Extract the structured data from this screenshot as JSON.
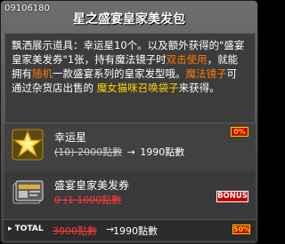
{
  "item_id": "09106180",
  "title": "星之盛宴皇家美发包",
  "description": {
    "line1": "飘洒展示道具：幸运星10个。以及额外获得的\"盛宴",
    "line2_a": "皇家美发券\"1张，持有魔法镜子时",
    "line2_b": "双击使用",
    "line2_c": "，就能",
    "line3_a": "拥有",
    "line3_b": "随机",
    "line3_c": "一款盛宴系列的皇家发型哦。",
    "line3_d": "魔法镜子",
    "line3_e": "可",
    "line4_a": "通过杂货店出售的 ",
    "line4_b": "魔女猫咪召唤袋子",
    "line4_c": "来获得。"
  },
  "items": [
    {
      "name": "幸运星",
      "old_price": "(10) 2000點數",
      "arrow": "→",
      "new_price": "1990點數",
      "badge": "0%"
    },
    {
      "name": "盛宴皇家美发券",
      "old_price": "0 (1 1000點數",
      "bonus": "BONUS"
    }
  ],
  "total": {
    "label": "TOTAL",
    "old_price": "3000點數",
    "arrow": "→",
    "new_price": "1990點數",
    "badge": "50%"
  },
  "colors": {
    "highlight_orange": "#ff7a00",
    "highlight_yellow": "#ffd400",
    "price_strike_red": "#ff3b3b"
  },
  "icons": {
    "item1": "star-icon",
    "item2": "coupon-card-icon"
  }
}
